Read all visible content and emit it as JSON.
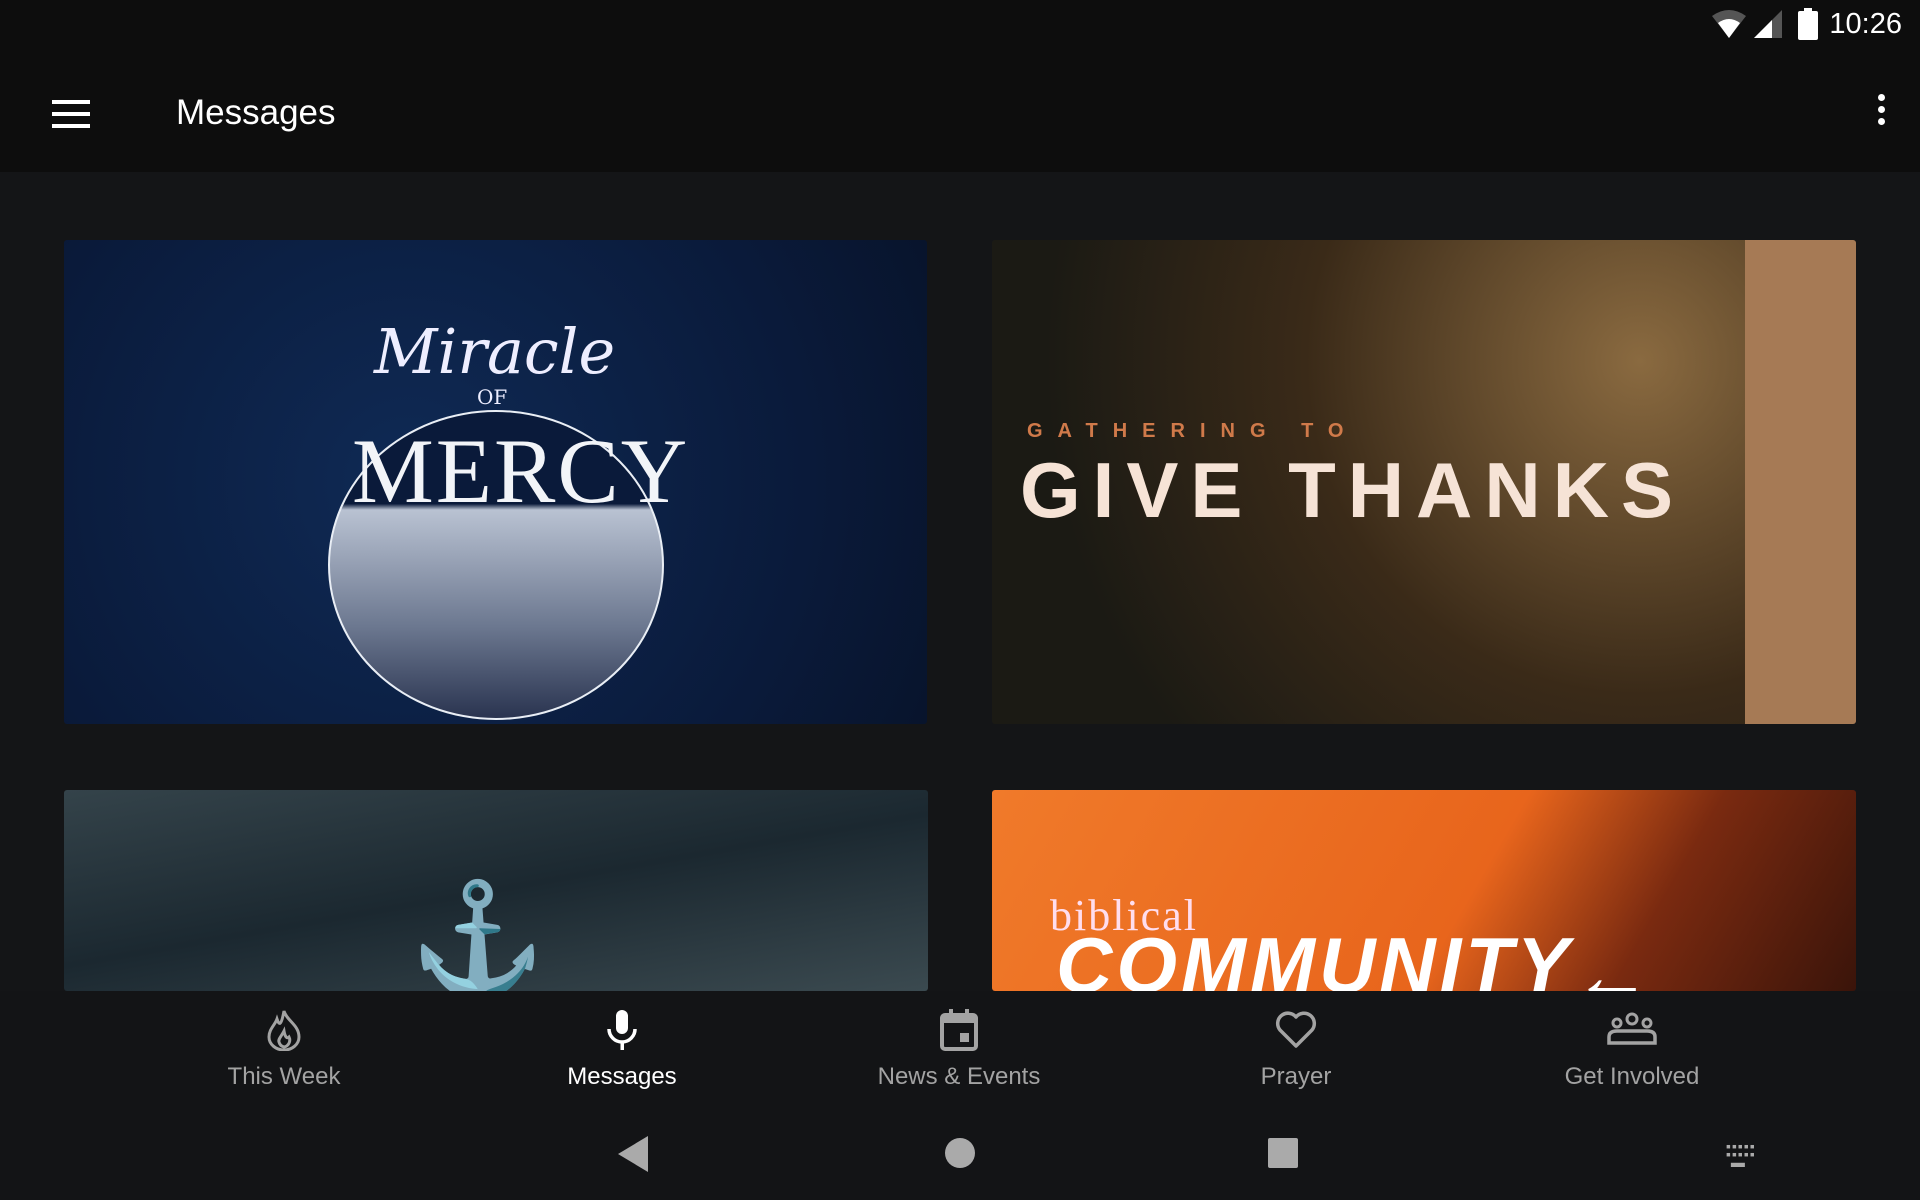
{
  "status_bar": {
    "time": "10:26",
    "icons": [
      "wifi-icon",
      "signal-icon",
      "battery-icon"
    ]
  },
  "app_bar": {
    "title": "Messages",
    "menu_icon": "hamburger-icon",
    "more_icon": "more-vert-icon"
  },
  "cards": [
    {
      "title_art": "Miracle of Mercy",
      "line1": "Miracle",
      "line2": "OF",
      "line3": "MERCY",
      "bg_color": "#0a1a3a"
    },
    {
      "title_art": "Gathering to Give Thanks",
      "line1": "GATHERING TO",
      "line2": "GIVE THANKS",
      "accent": "#a67a55"
    },
    {
      "title_art": "Anchor",
      "bg_color": "#1b2830"
    },
    {
      "title_art": "biblical Community",
      "line1": "biblical",
      "line2": "COMMUNITY",
      "bg_color": "#e8651c"
    }
  ],
  "bottom_nav": {
    "active": "Messages",
    "items": [
      {
        "label": "This Week",
        "icon": "flame-icon"
      },
      {
        "label": "Messages",
        "icon": "microphone-icon"
      },
      {
        "label": "News & Events",
        "icon": "calendar-icon"
      },
      {
        "label": "Prayer",
        "icon": "heart-icon"
      },
      {
        "label": "Get Involved",
        "icon": "group-icon"
      }
    ]
  },
  "system_nav": [
    "back",
    "home",
    "recents",
    "keyboard"
  ]
}
